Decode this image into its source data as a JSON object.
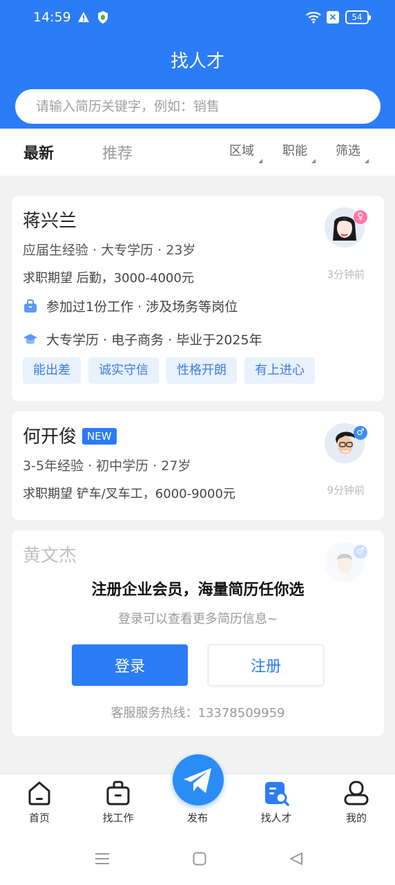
{
  "status_bar": {
    "time": "14:59",
    "battery": "54"
  },
  "header": {
    "title": "找人才"
  },
  "search": {
    "placeholder": "请输入简历关键字，例如：销售"
  },
  "tabs": {
    "latest": "最新",
    "recommend": "推荐"
  },
  "filters": {
    "area": "区域",
    "job": "职能",
    "screen": "筛选"
  },
  "candidates": [
    {
      "name": "蒋兴兰",
      "info": "应届生经验 · 大专学历 · 23岁",
      "expect": "求职期望 后勤，3000-4000元",
      "time": "3分钟前",
      "gender": "female",
      "experience": "参加过1份工作 · 涉及场务等岗位",
      "education": "大专学历 · 电子商务 · 毕业于2025年",
      "tags": [
        "能出差",
        "诚实守信",
        "性格开朗",
        "有上进心"
      ]
    },
    {
      "name": "何开俊",
      "badge": "NEW",
      "info": "3-5年经验 · 初中学历 · 27岁",
      "expect": "求职期望 铲车/叉车工，6000-9000元",
      "time": "9分钟前",
      "gender": "male"
    },
    {
      "name": "黄文杰",
      "gender": "male"
    }
  ],
  "login_prompt": {
    "title": "注册企业会员，海量简历任你选",
    "subtitle": "登录可以查看更多简历信息~",
    "login_label": "登录",
    "register_label": "注册",
    "hotline": "客服服务热线：13378509959"
  },
  "bottom_nav": {
    "home": "首页",
    "find_job": "找工作",
    "post": "发布",
    "find_talent": "找人才",
    "mine": "我的"
  },
  "colors": {
    "primary": "#2b7cf6",
    "tag_bg": "#e9f1fd",
    "female": "#ff7aa2",
    "male": "#3d8cf5"
  }
}
